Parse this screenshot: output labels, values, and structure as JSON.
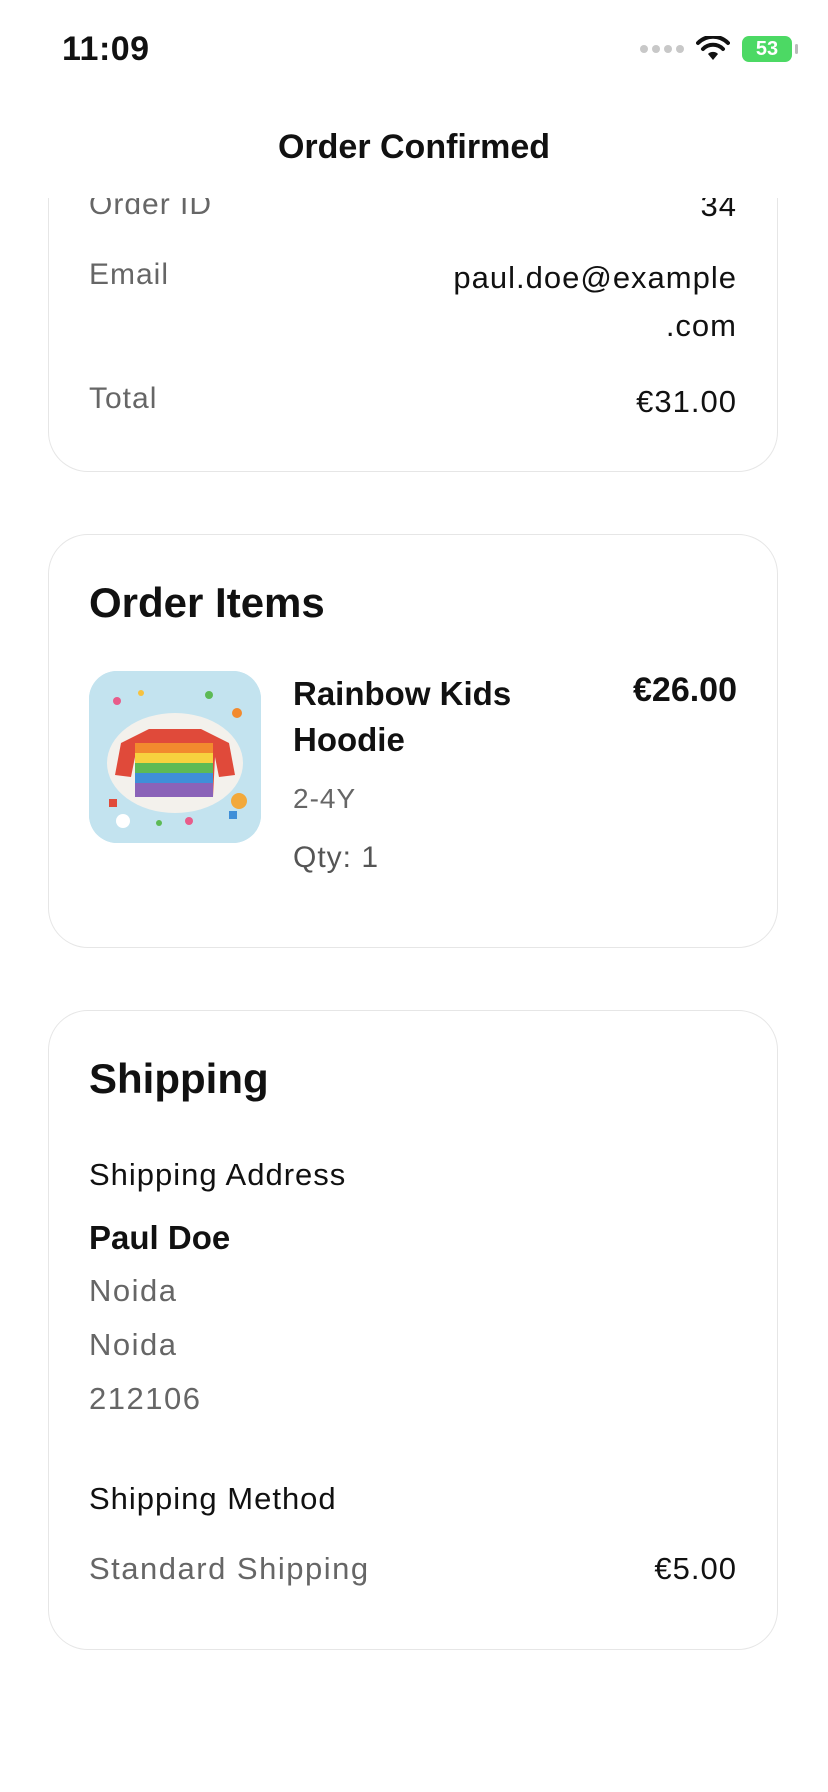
{
  "status": {
    "time": "11:09",
    "battery": "53"
  },
  "nav": {
    "title": "Order Confirmed"
  },
  "summary": {
    "order_id_label": "Order ID",
    "order_id_value": "34",
    "email_label": "Email",
    "email_value_line1": "paul.doe@example",
    "email_value_line2": ".com",
    "total_label": "Total",
    "total_value": "€31.00"
  },
  "items": {
    "title": "Order Items",
    "list": [
      {
        "name": "Rainbow Kids Hoodie",
        "variant": "2-4Y",
        "qty": "Qty: 1",
        "price": "€26.00"
      }
    ]
  },
  "shipping": {
    "title": "Shipping",
    "address_label": "Shipping Address",
    "name": "Paul Doe",
    "line1": "Noida",
    "line2": "Noida",
    "postcode": "212106",
    "method_label": "Shipping Method",
    "method_name": "Standard Shipping",
    "method_price": "€5.00"
  },
  "colors": {
    "battery": "#4cd964",
    "muted_text": "#666666",
    "card_border": "#e6e6e6"
  }
}
